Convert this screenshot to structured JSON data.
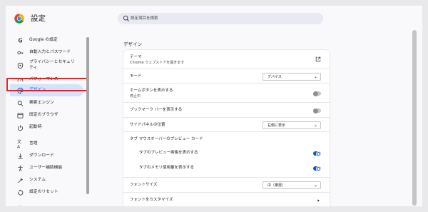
{
  "app": {
    "title": "設定"
  },
  "search": {
    "placeholder": "設定項目を検索"
  },
  "sidebar": {
    "items": [
      {
        "label": "Google の設定"
      },
      {
        "label": "自動入力とパスワード"
      },
      {
        "label_line1": "プライバシーとセキュリ",
        "label_line2": "ティ"
      },
      {
        "label": "パフォーマンス"
      },
      {
        "label": "デザイン"
      },
      {
        "label": "検索エンジン"
      },
      {
        "label": "既定のブラウザ"
      },
      {
        "label": "起動時"
      },
      {
        "label": "言語"
      },
      {
        "label": "ダウンロード"
      },
      {
        "label": "ユーザー補助機能"
      },
      {
        "label": "システム"
      },
      {
        "label": "設定のリセット"
      }
    ]
  },
  "main": {
    "section_title": "デザイン",
    "rows": {
      "theme": {
        "label": "テーマ",
        "sublabel": "Chrome ウェブストアを開きます"
      },
      "mode": {
        "label": "モード",
        "value": "デバイス"
      },
      "home_button": {
        "label": "ホームボタンを表示する",
        "sublabel": "停止中",
        "enabled": false
      },
      "bookmark_bar": {
        "label": "ブックマーク バーを表示する",
        "enabled": false
      },
      "side_panel": {
        "label": "サイドパネルの位置",
        "value": "右側に表示"
      },
      "tab_hover": {
        "label": "タブ マウスオーバーのプレビュー カード"
      },
      "tab_preview_image": {
        "label": "タブのプレビュー画像を表示する",
        "enabled": true
      },
      "tab_memory": {
        "label": "タブのメモリ使用量を表示する",
        "enabled": true
      },
      "font_size": {
        "label": "フォントサイズ",
        "value": "中（推奨）"
      },
      "customize_fonts": {
        "label": "フォントをカスタマイズ"
      }
    }
  },
  "colors": {
    "accent": "#0b57d0",
    "active_bg": "#d3e3fd",
    "highlight_border": "#e0262a",
    "toggle_off": "#c7c7c7"
  }
}
